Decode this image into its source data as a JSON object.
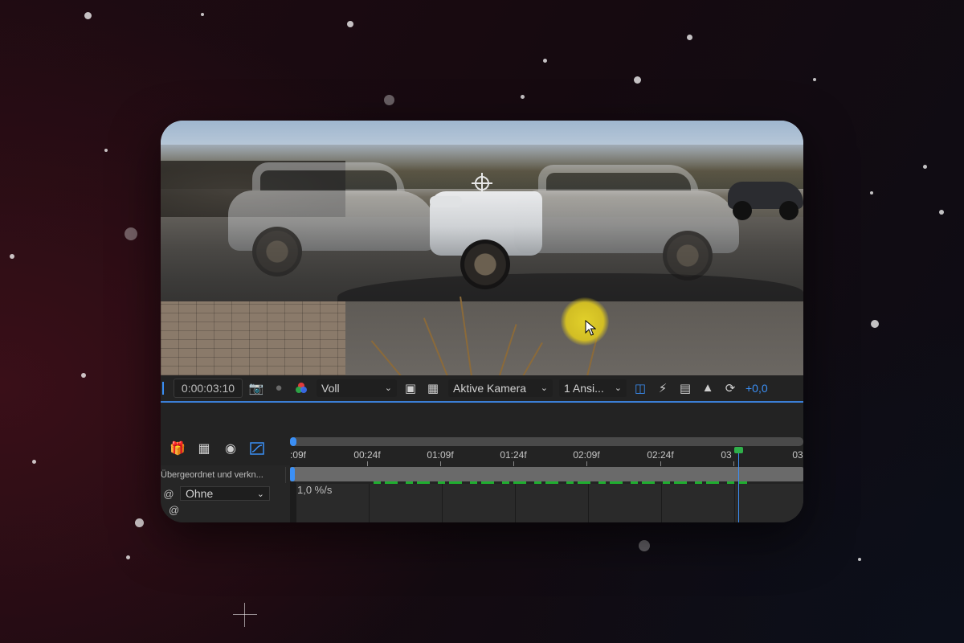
{
  "viewer_toolbar": {
    "timecode": "0:00:03:10",
    "resolution": "Voll",
    "camera": "Aktive Kamera",
    "views": "1 Ansi...",
    "exposure": "+0,0",
    "icons": [
      "snapshot-icon",
      "show-snapshot-icon",
      "channel-icon",
      "region-of-interest-icon",
      "transparency-grid-icon",
      "fast-previews-icon",
      "timeline-icon",
      "flowchart-icon",
      "reset-exposure-icon"
    ]
  },
  "timeline": {
    "ticks": [
      ":09f",
      "00:24f",
      "01:09f",
      "01:24f",
      "02:09f",
      "02:24f",
      "03",
      "03"
    ],
    "parent_header": "Übergeordnet und verkn...",
    "parent_value": "Ohne",
    "speed_label": "1,0 %/s",
    "playhead_time": "03:10",
    "icons": [
      "comp-marker-icon",
      "frame-blending-icon",
      "motion-blur-icon",
      "graph-editor-icon"
    ]
  },
  "colors": {
    "accent": "#3b8ff5",
    "keyframe_bar": "#1fae2f",
    "cursor_highlight": "#e3d020"
  }
}
